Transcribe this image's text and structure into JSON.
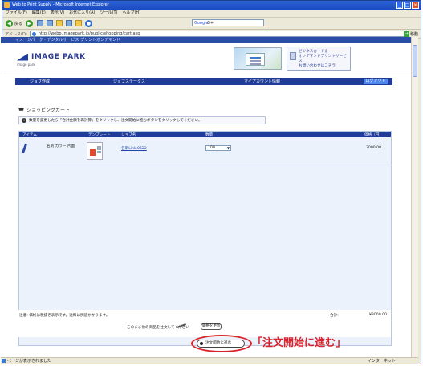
{
  "browser": {
    "title": "Web to Print Supply - Microsoft Internet Explorer",
    "menu": [
      "ファイル(F)",
      "編集(E)",
      "表示(V)",
      "お気に入り(A)",
      "ツール(T)",
      "ヘルプ(H)"
    ],
    "toolbar": {
      "back_label": "戻る",
      "google_label": "Google",
      "google_value": "G+"
    },
    "address_label": "アドレス(D)",
    "address_value": "http://webp.imagepark.jp/public/shopping/cart.asp",
    "go_label": "移動",
    "status_text": "ページが表示されました",
    "zone_text": "インターネット"
  },
  "site": {
    "top_strip": "イメージパーク・デジタルサービス  プリントオンデマンド",
    "logo_text": "IMAGE PARK",
    "logo_sub": "image park",
    "banner_lines": [
      "ビジネスカード＆",
      "オンデマンドプリントサービス",
      "お問い合わせはコチラ"
    ],
    "nav": {
      "tabs": [
        "ジョブ作成",
        "ジョブステータス",
        "マイアカウント情報"
      ],
      "logout": "ログアウト"
    }
  },
  "cart": {
    "title": "ショッピングカート",
    "info": "数量を変更したら「合計金額を再計算」をクリックし、注文開始に進むボタンをクリックしてください。",
    "columns": [
      "アイテム",
      "テンプレート",
      "ジョブ名",
      "数量",
      "価格（円）"
    ],
    "rows": [
      {
        "item": "名刺 カラー 片面",
        "job": "名刺Link.0622",
        "qty": "100",
        "price": "3000.00"
      }
    ],
    "footer_note": "注意: 価格は税抜き表示です。送料は別途かかります。",
    "total_label": "合計:",
    "total_value": "¥3000.00",
    "continue_text": "このまま他の商品を注文してください",
    "update_button": "価格を更新",
    "order_button": "注文開始に進む"
  },
  "annotation": {
    "callout": "「注文開始に進む」",
    "color": "#d8232a"
  }
}
